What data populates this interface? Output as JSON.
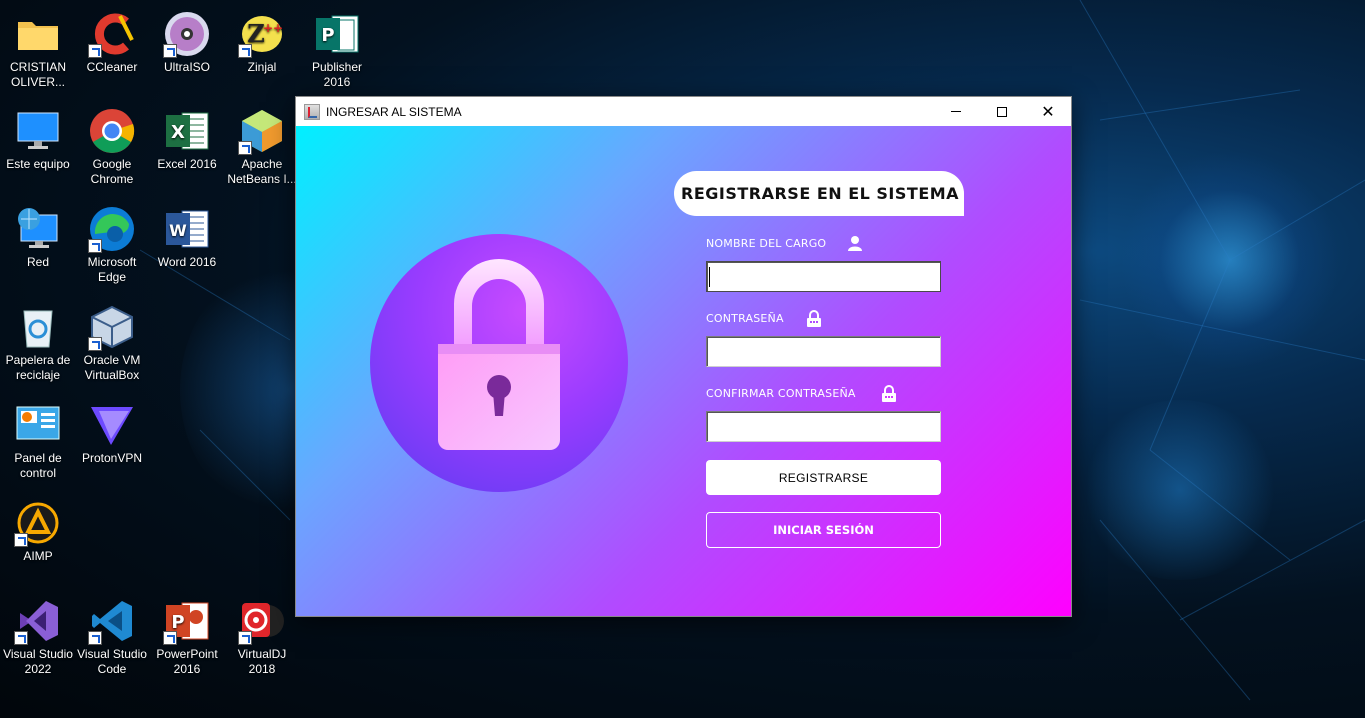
{
  "desktop": {
    "icons": [
      {
        "label": "CRISTIAN OLIVER...",
        "icon": "folder-icon"
      },
      {
        "label": "CCleaner",
        "icon": "ccleaner-icon"
      },
      {
        "label": "UltraISO",
        "icon": "ultraiso-icon"
      },
      {
        "label": "Zinjal",
        "icon": "zinjal-icon"
      },
      {
        "label": "Publisher 2016",
        "icon": "publisher-icon"
      },
      {
        "label": "Este equipo",
        "icon": "computer-icon"
      },
      {
        "label": "Google Chrome",
        "icon": "chrome-icon"
      },
      {
        "label": "Excel 2016",
        "icon": "excel-icon"
      },
      {
        "label": "Apache NetBeans I...",
        "icon": "netbeans-icon"
      },
      {
        "label": "Red",
        "icon": "network-icon"
      },
      {
        "label": "Microsoft Edge",
        "icon": "edge-icon"
      },
      {
        "label": "Word 2016",
        "icon": "word-icon"
      },
      {
        "label": "Papelera de reciclaje",
        "icon": "recycle-bin-icon"
      },
      {
        "label": "Oracle VM VirtualBox",
        "icon": "virtualbox-icon"
      },
      {
        "label": "Panel de control",
        "icon": "control-panel-icon"
      },
      {
        "label": "ProtonVPN",
        "icon": "protonvpn-icon"
      },
      {
        "label": "AIMP",
        "icon": "aimp-icon"
      },
      {
        "label": "Visual Studio 2022",
        "icon": "visual-studio-icon"
      },
      {
        "label": "Visual Studio Code",
        "icon": "vscode-icon"
      },
      {
        "label": "PowerPoint 2016",
        "icon": "powerpoint-icon"
      },
      {
        "label": "VirtualDJ 2018",
        "icon": "virtualdj-icon"
      }
    ]
  },
  "window": {
    "title": "INGRESAR AL SISTEMA",
    "controls": {
      "minimize": "minimize-icon",
      "maximize": "maximize-icon",
      "close": "close-icon"
    }
  },
  "form": {
    "heading": "REGISTRARSE EN EL SISTEMA",
    "fields": [
      {
        "label": "NOMBRE DEL CARGO",
        "icon": "user-icon",
        "value": ""
      },
      {
        "label": "CONTRASEÑA",
        "icon": "lock-icon",
        "value": ""
      },
      {
        "label": "CONFIRMAR CONTRASEÑA",
        "icon": "lock-icon",
        "value": ""
      }
    ],
    "register_button": "REGISTRARSE",
    "login_button": "INICIAR SESIÓN"
  },
  "colors": {
    "gradient_start": "#00f0ff",
    "gradient_mid": "#b04cff",
    "gradient_end": "#ff00ff"
  }
}
